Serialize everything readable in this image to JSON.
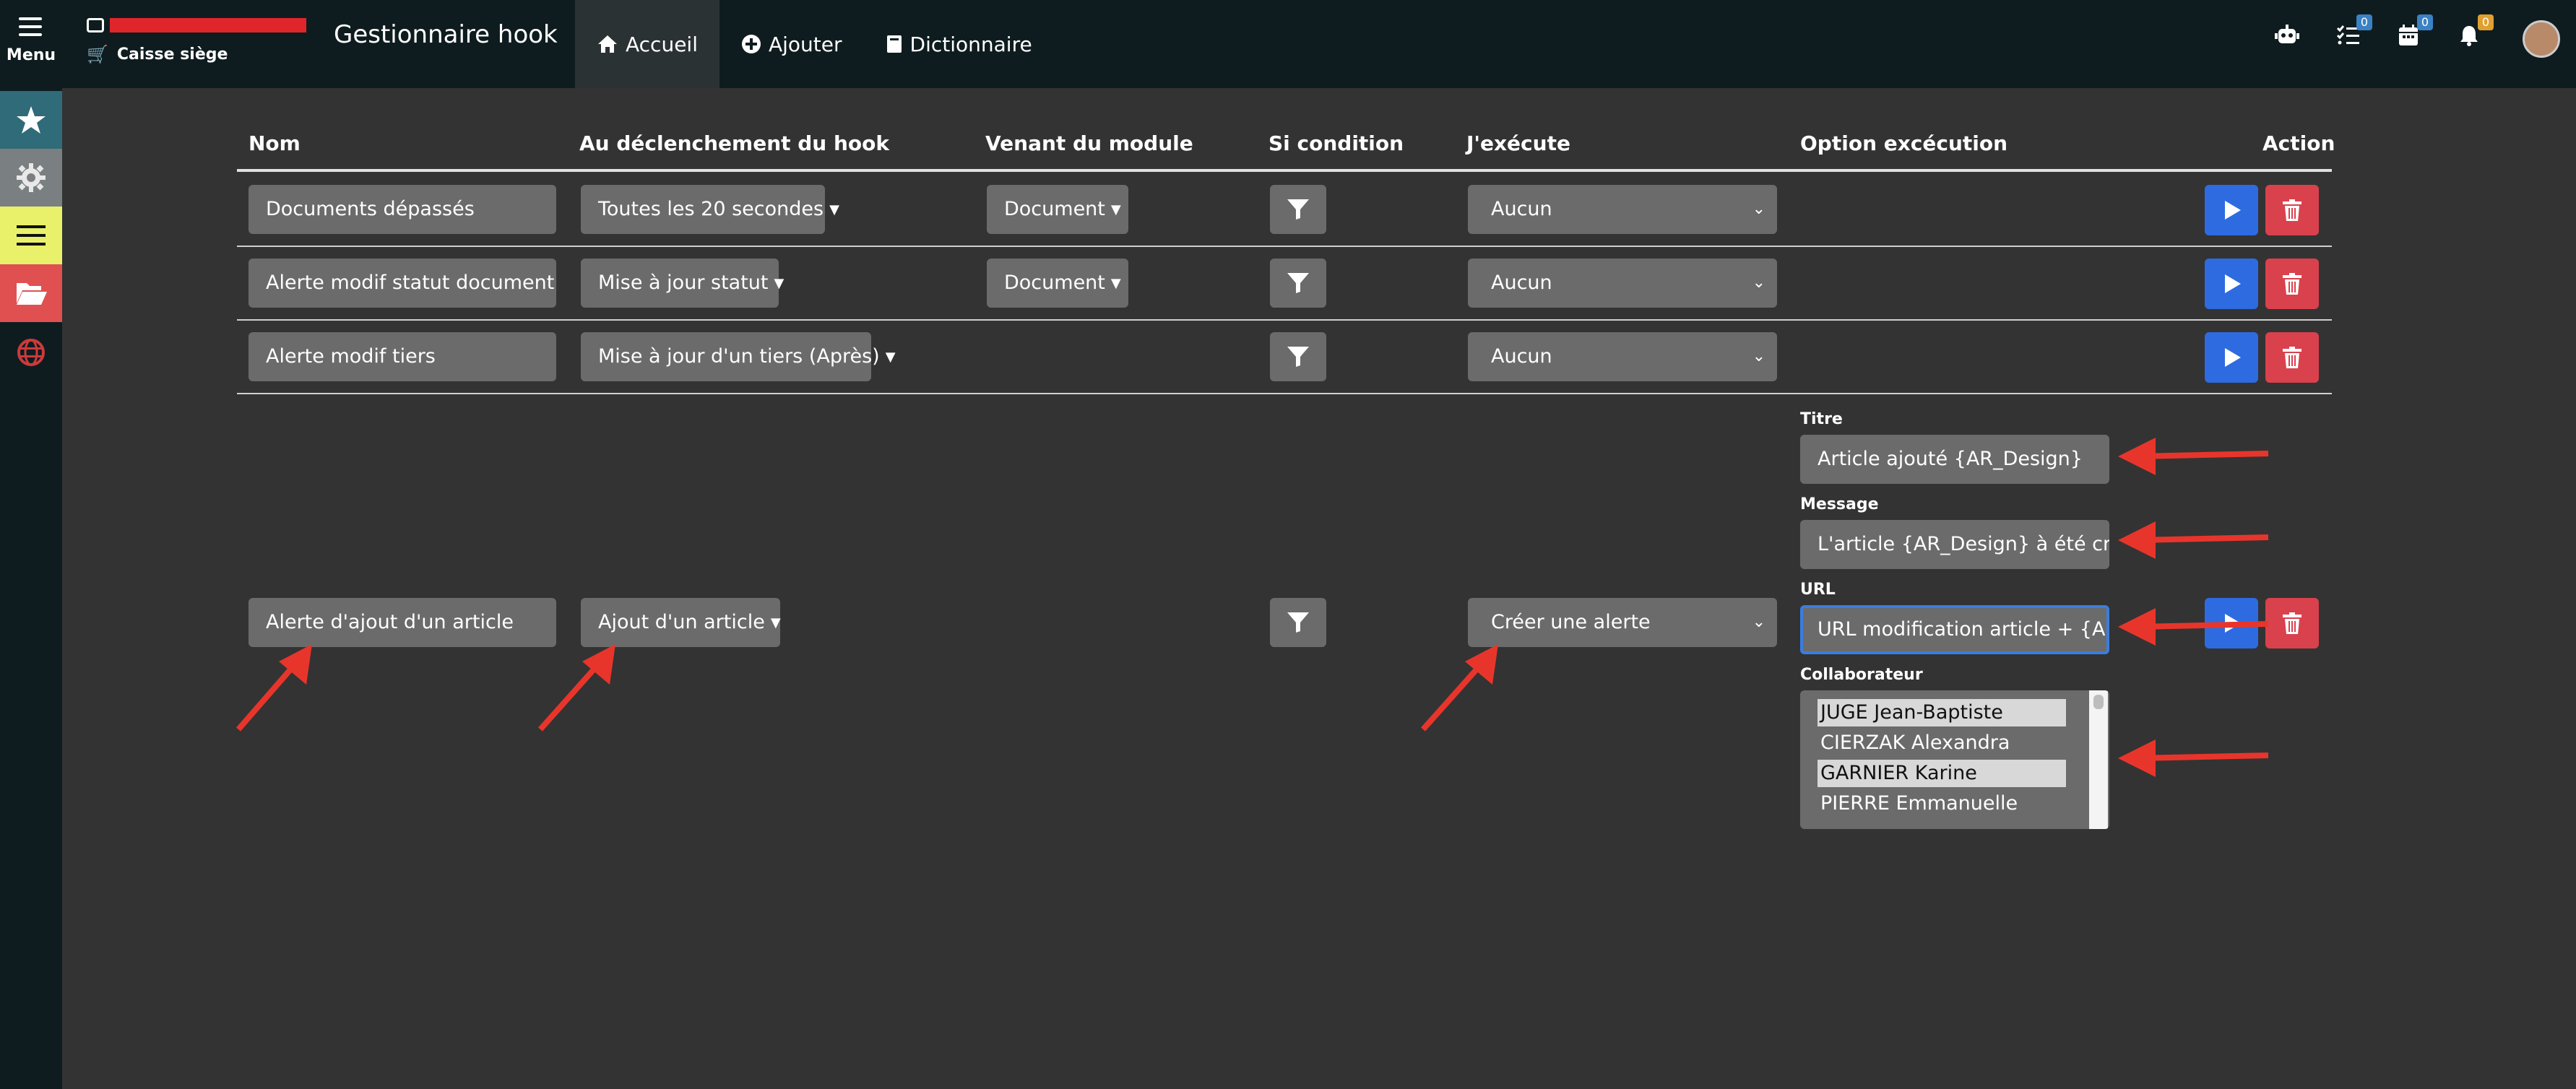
{
  "topbar": {
    "menu_label": "Menu",
    "company_line2": "Caisse siège",
    "app_title": "Gestionnaire hook",
    "nav": [
      {
        "label": "Accueil",
        "icon": "home-icon"
      },
      {
        "label": "Ajouter",
        "icon": "plus-circle-icon"
      },
      {
        "label": "Dictionnaire",
        "icon": "book-icon"
      }
    ],
    "badges": {
      "tasks": "0",
      "calendar": "0",
      "notifications": "0"
    }
  },
  "sidebar": {
    "items": [
      {
        "icon": "star-icon"
      },
      {
        "icon": "gear-icon"
      },
      {
        "icon": "list-icon"
      },
      {
        "icon": "folder-open-icon"
      },
      {
        "icon": "globe-icon"
      }
    ]
  },
  "table": {
    "headers": {
      "nom": "Nom",
      "declenchement": "Au déclenchement du hook",
      "module": "Venant du module",
      "condition": "Si condition",
      "execute": "J'exécute",
      "option": "Option excécution",
      "action": "Action"
    },
    "rows": [
      {
        "nom": "Documents dépassés",
        "trigger": "Toutes les 20 secondes",
        "module": "Document",
        "execute": "Aucun"
      },
      {
        "nom": "Alerte modif statut document",
        "trigger": "Mise à jour statut",
        "module": "Document",
        "execute": "Aucun"
      },
      {
        "nom": "Alerte modif tiers",
        "trigger": "Mise à jour d'un tiers (Après)",
        "module": "",
        "execute": "Aucun"
      },
      {
        "nom": "Alerte d'ajout d'un article",
        "trigger": "Ajout d'un article",
        "module": "",
        "execute": "Créer une alerte"
      }
    ],
    "options": {
      "titre_label": "Titre",
      "titre_value": "Article ajouté {AR_Design}",
      "message_label": "Message",
      "message_value": "L'article {AR_Design} à été créer,",
      "url_label": "URL",
      "url_value": "URL modification article + {AR_R",
      "collab_label": "Collaborateur",
      "collaborateurs": [
        {
          "name": "JUGE Jean-Baptiste",
          "selected": true
        },
        {
          "name": "CIERZAK Alexandra",
          "selected": false
        },
        {
          "name": "GARNIER Karine",
          "selected": true
        },
        {
          "name": "PIERRE Emmanuelle",
          "selected": false
        }
      ]
    }
  },
  "colors": {
    "topbar": "#0f1c1f",
    "background": "#333333",
    "field": "#6b6b6b",
    "play": "#2f6be0",
    "trash": "#d9414d",
    "annotation_arrow": "#e8352b"
  }
}
